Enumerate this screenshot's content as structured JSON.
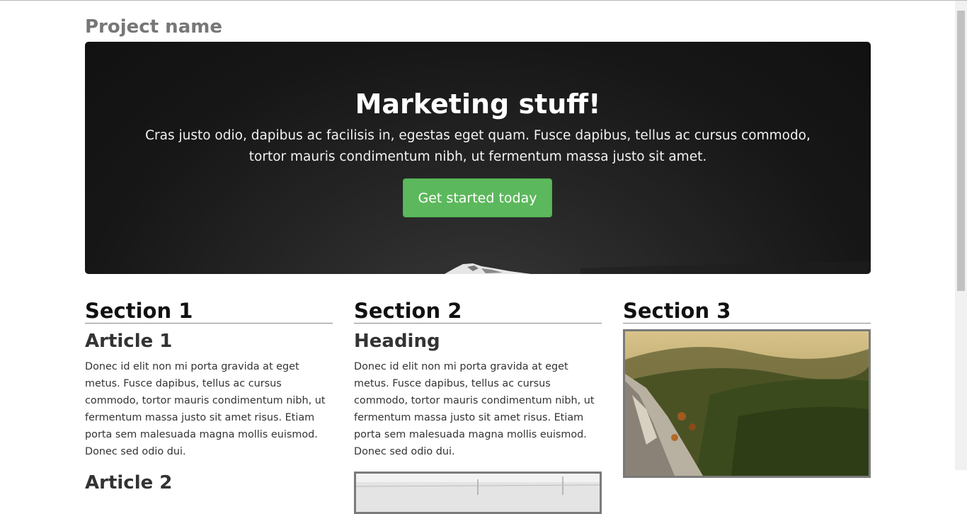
{
  "header": {
    "brand": "Project name"
  },
  "hero": {
    "title": "Marketing stuff!",
    "text": "Cras justo odio, dapibus ac facilisis in, egestas eget quam. Fusce dapibus, tellus ac cursus commodo, tortor mauris condimentum nibh, ut fermentum massa justo sit amet.",
    "button_label": "Get started today",
    "button_color": "#5cb85c"
  },
  "sections": [
    {
      "title": "Section 1",
      "article1_title": "Article 1",
      "article1_text": "Donec id elit non mi porta gravida at eget metus. Fusce dapibus, tellus ac cursus commodo, tortor mauris condimentum nibh, ut fermentum massa justo sit amet risus. Etiam porta sem malesuada magna mollis euismod. Donec sed odio dui.",
      "article2_title": "Article 2"
    },
    {
      "title": "Section 2",
      "heading": "Heading",
      "text": "Donec id elit non mi porta gravida at eget metus. Fusce dapibus, tellus ac cursus commodo, tortor mauris condimentum nibh, ut fermentum massa justo sit amet risus. Etiam porta sem malesuada magna mollis euismod. Donec sed odio dui."
    },
    {
      "title": "Section 3"
    }
  ]
}
